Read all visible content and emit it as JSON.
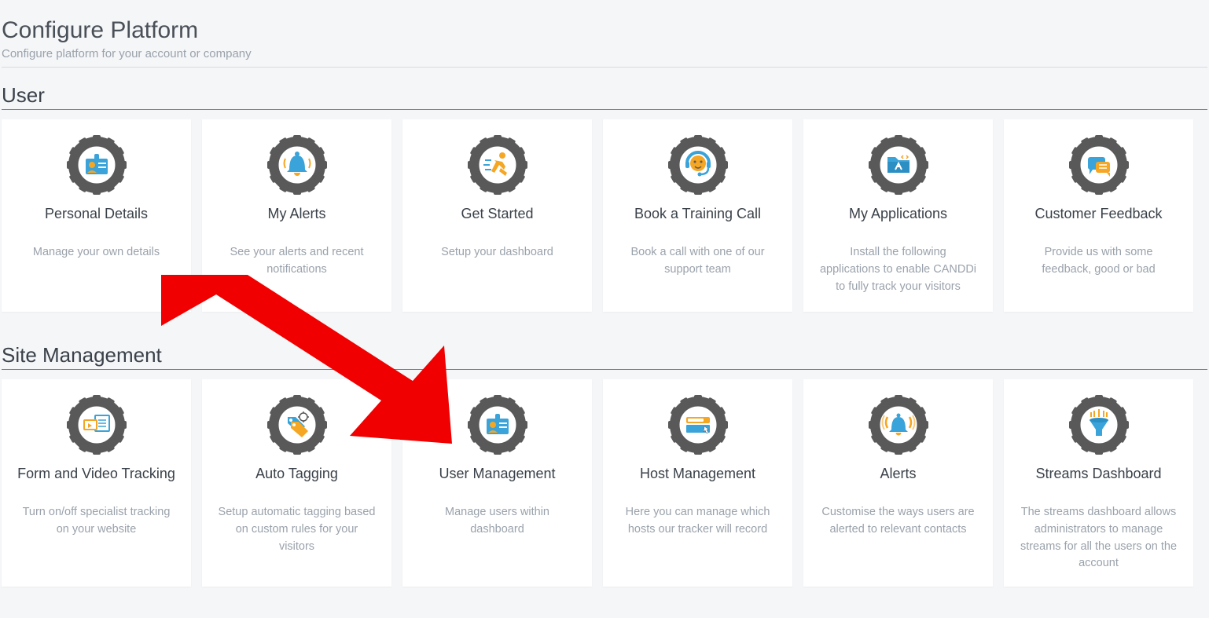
{
  "header": {
    "title": "Configure Platform",
    "subtitle": "Configure platform for your account or company"
  },
  "sections": {
    "user": {
      "label": "User",
      "cards": [
        {
          "title": "Personal Details",
          "desc": "Manage your own details",
          "icon": "id-card"
        },
        {
          "title": "My Alerts",
          "desc": "See your alerts and recent notifications",
          "icon": "bell"
        },
        {
          "title": "Get Started",
          "desc": "Setup your dashboard",
          "icon": "runner"
        },
        {
          "title": "Book a Training Call",
          "desc": "Book a call with one of our support team",
          "icon": "headset"
        },
        {
          "title": "My Applications",
          "desc": "Install the following applications to enable CANDDi to fully track your visitors",
          "icon": "folder-apps"
        },
        {
          "title": "Customer Feedback",
          "desc": "Provide us with some feedback, good or bad",
          "icon": "chat"
        }
      ]
    },
    "site": {
      "label": "Site Management",
      "cards": [
        {
          "title": "Form and Video Tracking",
          "desc": "Turn on/off specialist tracking on your website",
          "icon": "video-form"
        },
        {
          "title": "Auto Tagging",
          "desc": "Setup automatic tagging based on custom rules for your visitors",
          "icon": "tags"
        },
        {
          "title": "User Management",
          "desc": "Manage users within dashboard",
          "icon": "id-card"
        },
        {
          "title": "Host Management",
          "desc": "Here you can manage which hosts our tracker will record",
          "icon": "browser"
        },
        {
          "title": "Alerts",
          "desc": "Customise the ways users are alerted to relevant contacts",
          "icon": "bell-wave"
        },
        {
          "title": "Streams Dashboard",
          "desc": "The streams dashboard allows administrators to manage streams for all the users on the account",
          "icon": "funnel"
        }
      ]
    }
  },
  "annotation": {
    "arrow_color": "#f00000",
    "points_to": "User Management"
  }
}
